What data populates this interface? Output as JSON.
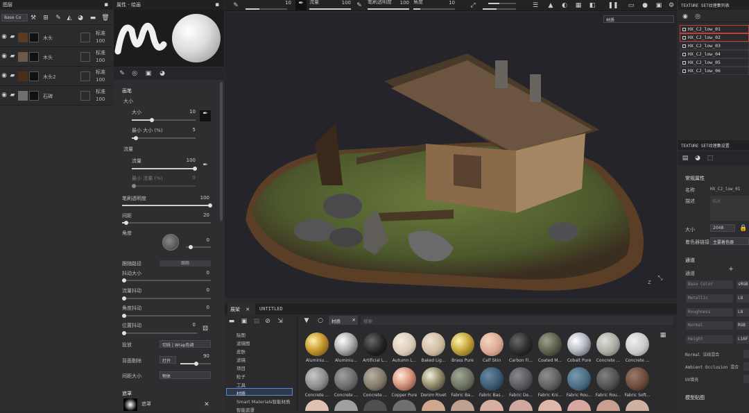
{
  "layers": {
    "title": "图层",
    "channel": "Base Co",
    "rows": [
      {
        "name": "木头",
        "blend": "标准",
        "opacity": "100"
      },
      {
        "name": "木头",
        "blend": "标准",
        "opacity": "100"
      },
      {
        "name": "木头2",
        "blend": "标准",
        "opacity": "100"
      },
      {
        "name": "石碑",
        "blend": "标准",
        "opacity": "100"
      }
    ]
  },
  "props": {
    "title": "属性 - 绘画",
    "section_brush": "画笔",
    "size_label": "大小",
    "size_val": "10",
    "min_size_label": "最小 大小 (%)",
    "min_size_val": "5",
    "flow_section": "流量",
    "flow_label": "流量",
    "flow_val": "100",
    "min_flow_label": "最小 流量 (%)",
    "min_flow_val": "0",
    "alpha_label": "笔刷透明度",
    "alpha_val": "100",
    "spacing_label": "间距",
    "spacing_val": "20",
    "angle_label": "角度",
    "angle_val": "0",
    "follow_label": "跟随路径",
    "follow_btn": "跟随",
    "jitter_size_label": "抖动大小",
    "jitter_size_val": "0",
    "jitter_flow_label": "流量抖动",
    "jitter_flow_val": "0",
    "jitter_angle_label": "角度抖动",
    "jitter_angle_val": "0",
    "jitter_pos_label": "位置抖动",
    "jitter_pos_val": "0",
    "backface_label": "投放",
    "backface_val": "切线 | Wrap色调",
    "backface_cull_label": "背面剔除",
    "backface_cull_val": "打开",
    "backface_angle": "90",
    "size_space_label": "间距大小",
    "size_space_val": "物体",
    "alpha_section": "遮罩",
    "alpha_item": "遮罩"
  },
  "toolbar": {
    "slider1_val": "10",
    "slider2_label": "流量",
    "slider2_val": "100",
    "slider3_label": "笔刷透明度",
    "slider3_val": "100",
    "slider4_label": "角度",
    "slider4_val": "10"
  },
  "viewport": {
    "mode": "材质",
    "axis": "Z"
  },
  "shelf": {
    "tab1": "展架",
    "tab2": "UNTITLED",
    "filter_tag": "材质",
    "search_placeholder": "搜索",
    "categories": [
      "贴图",
      "滤镜图",
      "皮肤",
      "滤镜",
      "项目",
      "粒子",
      "工具",
      "材质",
      "Smart Materials智能材质",
      "智能遮罩"
    ],
    "selected_category": "材质",
    "materials_row1": [
      "Aluminiu...",
      "Aluminiu...",
      "Artificial L...",
      "Autumn L...",
      "Baked Lig...",
      "Brass Pure",
      "Calf Skin",
      "Carbon Fi...",
      "Coated M...",
      "Cobalt Pure",
      "Concrete ...",
      "Concrete ..."
    ],
    "materials_row2": [
      "Concrete ...",
      "Concrete ...",
      "Concrete ...",
      "Copper Pure",
      "Denim Rivet",
      "Fabric Ba...",
      "Fabric Bas...",
      "Fabric De...",
      "Fabric Kni...",
      "Fabric Rou...",
      "Fabric Rou...",
      "Fabric Soft..."
    ]
  },
  "textureset_list": {
    "title": "TEXTURE SET纹理集列表",
    "items": [
      "HX_CJ_low_01",
      "HX_CJ_low_02",
      "HX_CJ_low_03",
      "HX_CJ_low_04",
      "HX_CJ_low_05",
      "HX_CJ_low_06"
    ]
  },
  "textureset_settings": {
    "title": "TEXTURE SET纹理集设置",
    "section_general": "常规属性",
    "name_label": "名称",
    "name_val": "HX_CJ_low_01",
    "desc_label": "描述",
    "desc_placeholder": "描述",
    "size_label": "大小",
    "size_val": "2048",
    "shader_label": "着色器链接",
    "shader_val": "主要着色器",
    "section_channels": "通道",
    "channels_label": "通道",
    "channels": [
      {
        "name": "Base Color",
        "fmt": "sRGB"
      },
      {
        "name": "Metallic",
        "fmt": "L8"
      },
      {
        "name": "Roughness",
        "fmt": "L8"
      },
      {
        "name": "Normal",
        "fmt": "RGB"
      },
      {
        "name": "Height",
        "fmt": "L16F"
      }
    ],
    "normal_mix_label": "Normal 法线混合",
    "ao_mix_label": "Ambient Occlusion 混合",
    "uv_label": "UV填充",
    "section_mesh": "模型贴图"
  }
}
